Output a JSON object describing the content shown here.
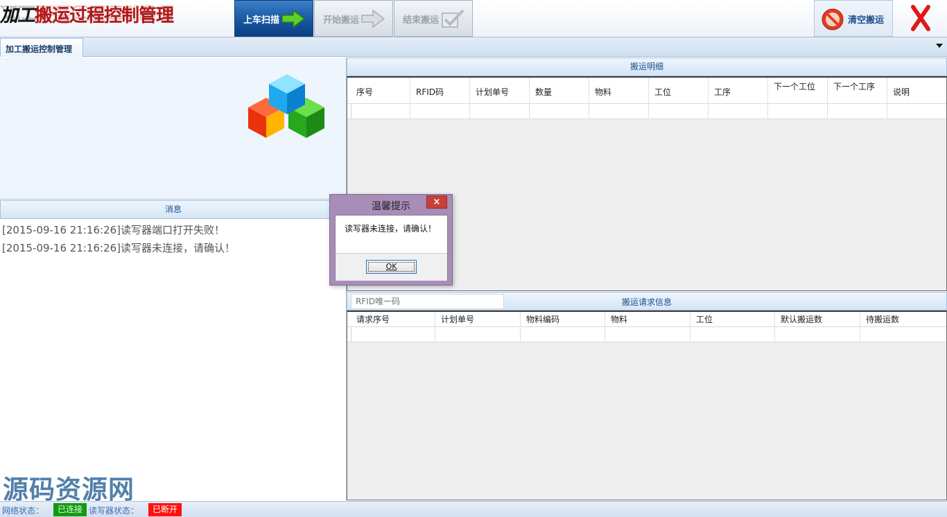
{
  "app": {
    "title_prefix": "加工",
    "title_rest": "搬运过程控制管理"
  },
  "toolbar": {
    "scan_label": "上车扫描",
    "start_label": "开始搬运",
    "end_label": "结束搬运",
    "clear_label": "清空搬运",
    "icons": {
      "scan": "arrow-right-icon",
      "start": "arrow-right-icon",
      "end": "checkmark-icon",
      "clear": "no-entry-icon",
      "close": "close-icon"
    },
    "colors": {
      "scan_active": "#1a5aa6",
      "close": "#e01818",
      "clear_icon": "#e53a1e"
    }
  },
  "tabs": [
    {
      "label": "加工搬运控制管理"
    }
  ],
  "messages": {
    "header": "消息",
    "lines": [
      "[2015-09-16 21:16:26]读写器端口打开失败！",
      "[2015-09-16 21:16:26]读写器未连接，请确认！"
    ]
  },
  "detail": {
    "header": "搬运明细",
    "columns": [
      "序号",
      "RFID码",
      "计划单号",
      "数量",
      "物料",
      "工位",
      "工序",
      "下一个工位",
      "下一个工序",
      "说明"
    ],
    "rows": []
  },
  "request": {
    "rfid_placeholder": "RFID唯一码",
    "header": "搬运请求信息",
    "columns": [
      "请求序号",
      "计划单号",
      "物料编码",
      "物料",
      "工位",
      "默认搬运数",
      "待搬运数"
    ],
    "rows": []
  },
  "dialog": {
    "title": "温馨提示",
    "message": "读写器未连接，请确认！",
    "ok_label": "OK",
    "close_glyph": "×"
  },
  "status": {
    "network_label": "网络状态：",
    "network_value": "已连接",
    "network_color": "#119a11",
    "reader_label": "读写器状态：",
    "reader_value": "已断开",
    "reader_color": "#ff1010"
  },
  "watermark": "源码资源网"
}
